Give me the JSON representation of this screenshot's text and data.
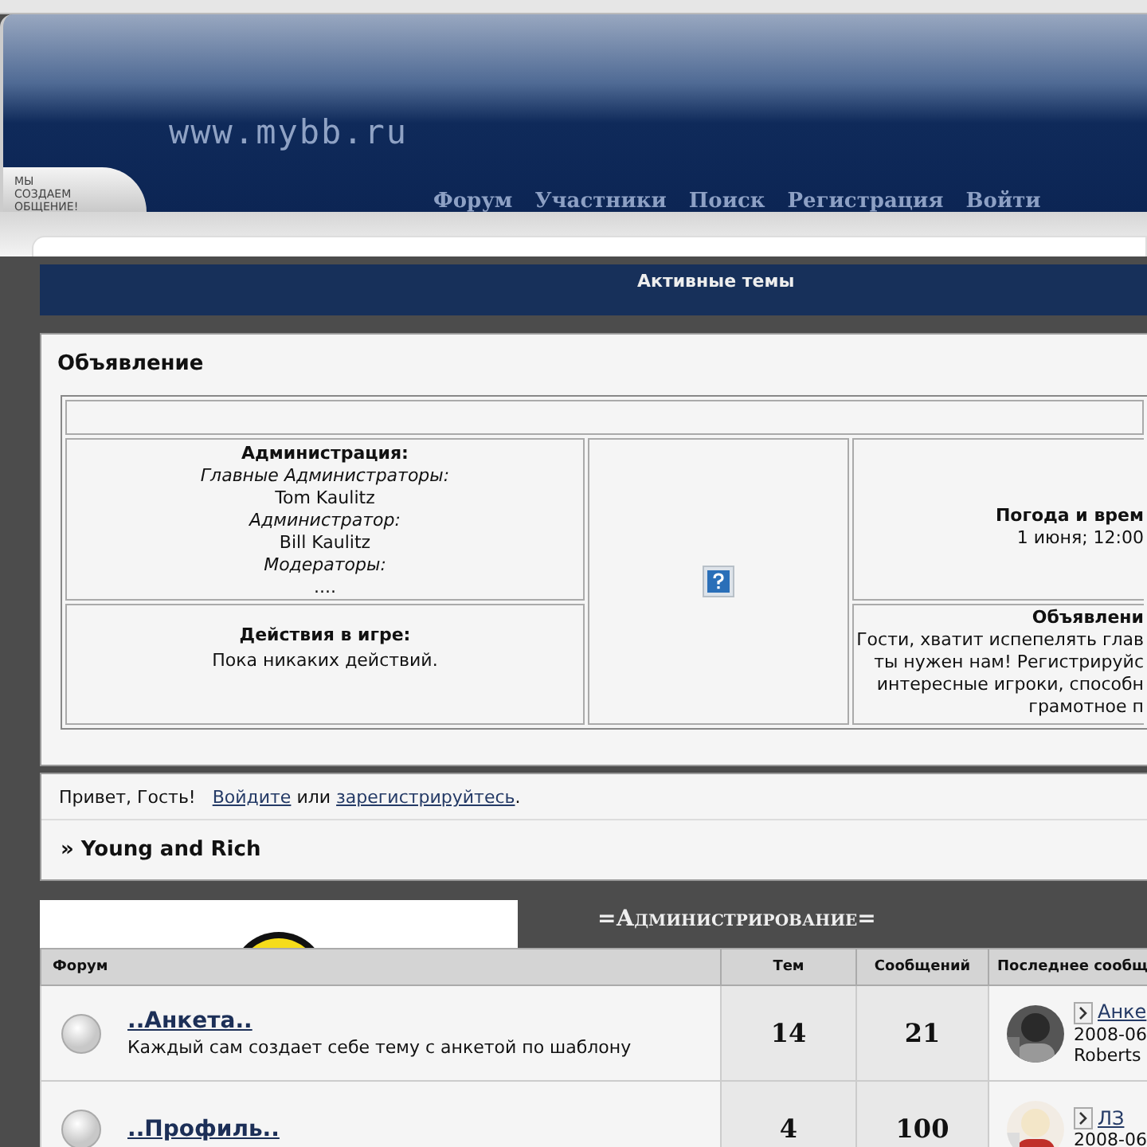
{
  "header": {
    "logo": "www.mybb.ru",
    "slogan": "МЫ СОЗДАЕМ ОБЩЕНИЕ!",
    "nav": [
      "Форум",
      "Участники",
      "Поиск",
      "Регистрация",
      "Войти"
    ]
  },
  "active_topics": {
    "title": "Активные темы"
  },
  "announcement": {
    "title": "Объявление",
    "administration": {
      "title": "Администрация:",
      "lines": [
        {
          "kind": "role",
          "text": "Главные Администраторы:"
        },
        {
          "kind": "name",
          "text": "Tom Kaulitz"
        },
        {
          "kind": "role",
          "text": "Администратор:"
        },
        {
          "kind": "name",
          "text": "Bill Kaulitz"
        },
        {
          "kind": "role",
          "text": "Модераторы:"
        },
        {
          "kind": "name",
          "text": "...."
        }
      ]
    },
    "game_actions": {
      "title": "Действия в игре:",
      "text": "Пока никаких действий."
    },
    "weather": {
      "title": "Погода и врем",
      "text": "1 июня; 12:00"
    },
    "notice": {
      "title": "Объявлени",
      "lines": [
        "Гости, хватит испепелять глав",
        "ты нужен нам! Регистрируйс",
        "интересные игроки, способн",
        "грамотное п"
      ]
    }
  },
  "welcome": {
    "greeting": "Привет, Гость!",
    "login_link": "Войдите",
    "middle": "или",
    "register_link": "зарегистрируйтесь",
    "end": "."
  },
  "breadcrumb": "» Young and Rich",
  "category": {
    "title": "=Администрирование="
  },
  "table": {
    "columns": [
      "Форум",
      "Тем",
      "Сообщений",
      "Последнее сообщ"
    ],
    "rows": [
      {
        "title": "..Анкета..",
        "description": "Каждый сам создает себе тему с анкетой по шаблону",
        "topics": "14",
        "posts": "21",
        "last_post": {
          "title": "Анке",
          "date": "2008-06",
          "author": "Roberts"
        }
      },
      {
        "title": "..Профиль..",
        "topics": "4",
        "posts": "100",
        "last_post": {
          "title": "ЛЗ",
          "date": "2008-06"
        }
      }
    ]
  }
}
